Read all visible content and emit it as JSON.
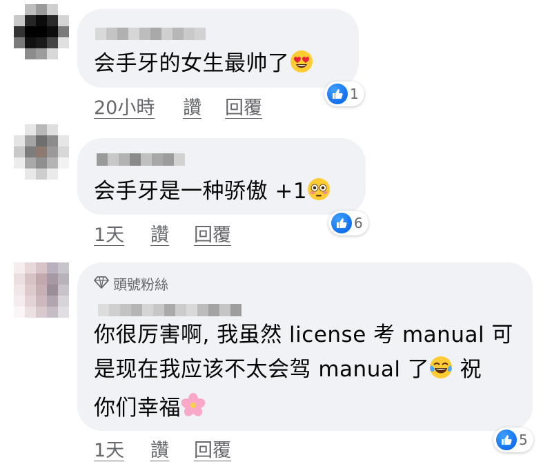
{
  "comments": [
    {
      "text": "会手牙的女生最帅了",
      "emoji": "heart-eyes-emoji",
      "time": "20小時",
      "like_label": "讚",
      "reply_label": "回覆",
      "reaction_count": "1"
    },
    {
      "text": "会手牙是一种骄傲 +1",
      "emoji": "flushed-face-emoji",
      "time": "1天",
      "like_label": "讚",
      "reply_label": "回覆",
      "reaction_count": "6"
    },
    {
      "badge": "頭號粉絲",
      "line1": "你很厉害啊, 我虽然 license 考 manual 可",
      "line2a": "是现在我应该不太会驾 manual 了",
      "line2b": " 祝",
      "line3": "你们幸福",
      "emoji1": "tears-of-joy-emoji",
      "emoji2": "cherry-blossom-emoji",
      "time": "1天",
      "like_label": "讚",
      "reply_label": "回覆",
      "reaction_count": "5"
    }
  ],
  "colors": {
    "bubble": "#f0f2f5",
    "meta_text": "#65676b",
    "like_blue": "#1877f2"
  }
}
